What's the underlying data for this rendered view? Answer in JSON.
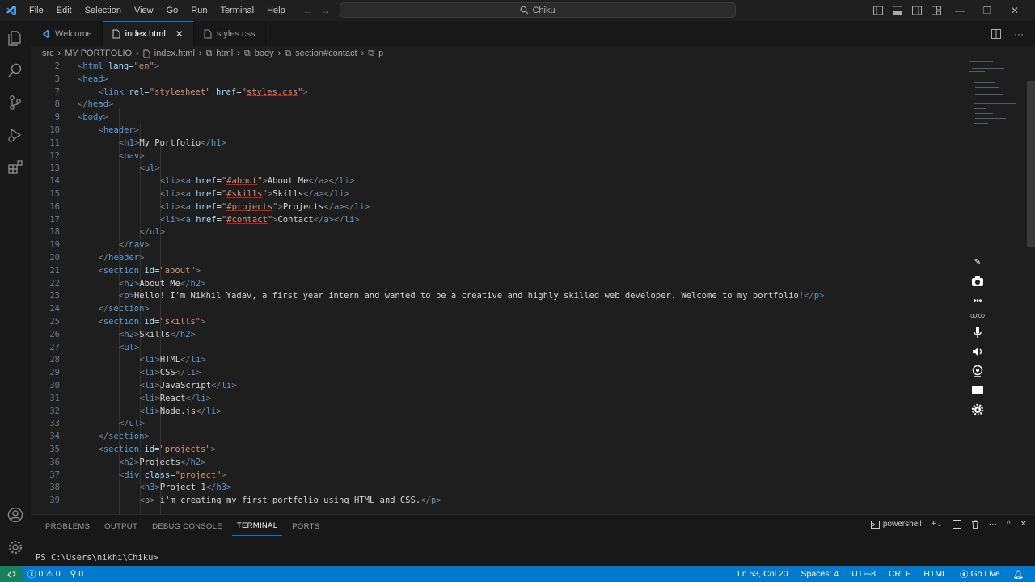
{
  "titlebar": {
    "menu": [
      "File",
      "Edit",
      "Selection",
      "View",
      "Go",
      "Run",
      "Terminal",
      "Help"
    ],
    "search_text": "Chiku"
  },
  "tabs": [
    {
      "label": "Welcome",
      "active": false
    },
    {
      "label": "index.html",
      "active": true
    },
    {
      "label": "styles.css",
      "active": false
    }
  ],
  "breadcrumb": [
    "src",
    "MY PORTFOLIO",
    "index.html",
    "html",
    "body",
    "section#contact",
    "p"
  ],
  "code_lines": [
    {
      "n": "2",
      "ind": 1,
      "t": [
        [
          "b",
          "<"
        ],
        [
          "g",
          "html"
        ],
        [
          "s",
          " "
        ],
        [
          "a",
          "lang"
        ],
        [
          "s",
          "="
        ],
        [
          "r",
          "\"en\""
        ],
        [
          "b",
          ">"
        ]
      ]
    },
    {
      "n": "3",
      "ind": 1,
      "t": [
        [
          "b",
          "<"
        ],
        [
          "g",
          "head"
        ],
        [
          "b",
          ">"
        ]
      ]
    },
    {
      "n": "7",
      "ind": 2,
      "t": [
        [
          "b",
          "<"
        ],
        [
          "g",
          "link"
        ],
        [
          "s",
          " "
        ],
        [
          "a",
          "rel"
        ],
        [
          "s",
          "="
        ],
        [
          "r",
          "\"stylesheet\""
        ],
        [
          "s",
          " "
        ],
        [
          "a",
          "href"
        ],
        [
          "s",
          "="
        ],
        [
          "r",
          "\""
        ],
        [
          "u",
          "styles.css"
        ],
        [
          "r",
          "\""
        ],
        [
          "b",
          ">"
        ]
      ]
    },
    {
      "n": "8",
      "ind": 1,
      "t": [
        [
          "b",
          "</"
        ],
        [
          "g",
          "head"
        ],
        [
          "b",
          ">"
        ]
      ]
    },
    {
      "n": "9",
      "ind": 1,
      "t": [
        [
          "b",
          "<"
        ],
        [
          "g",
          "body"
        ],
        [
          "b",
          ">"
        ]
      ]
    },
    {
      "n": "10",
      "ind": 2,
      "t": [
        [
          "b",
          "<"
        ],
        [
          "g",
          "header"
        ],
        [
          "b",
          ">"
        ]
      ]
    },
    {
      "n": "11",
      "ind": 3,
      "t": [
        [
          "b",
          "<"
        ],
        [
          "g",
          "h1"
        ],
        [
          "b",
          ">"
        ],
        [
          "x",
          "My Portfolio"
        ],
        [
          "b",
          "</"
        ],
        [
          "g",
          "h1"
        ],
        [
          "b",
          ">"
        ]
      ]
    },
    {
      "n": "12",
      "ind": 3,
      "t": [
        [
          "b",
          "<"
        ],
        [
          "g",
          "nav"
        ],
        [
          "b",
          ">"
        ]
      ]
    },
    {
      "n": "13",
      "ind": 4,
      "t": [
        [
          "b",
          "<"
        ],
        [
          "g",
          "ul"
        ],
        [
          "b",
          ">"
        ]
      ]
    },
    {
      "n": "14",
      "ind": 5,
      "t": [
        [
          "b",
          "<"
        ],
        [
          "g",
          "li"
        ],
        [
          "b",
          "><"
        ],
        [
          "g",
          "a"
        ],
        [
          "s",
          " "
        ],
        [
          "a",
          "href"
        ],
        [
          "s",
          "="
        ],
        [
          "r",
          "\""
        ],
        [
          "u",
          "#about"
        ],
        [
          "r",
          "\""
        ],
        [
          "b",
          ">"
        ],
        [
          "x",
          "About Me"
        ],
        [
          "b",
          "</"
        ],
        [
          "g",
          "a"
        ],
        [
          "b",
          "></"
        ],
        [
          "g",
          "li"
        ],
        [
          "b",
          ">"
        ]
      ]
    },
    {
      "n": "15",
      "ind": 5,
      "t": [
        [
          "b",
          "<"
        ],
        [
          "g",
          "li"
        ],
        [
          "b",
          "><"
        ],
        [
          "g",
          "a"
        ],
        [
          "s",
          " "
        ],
        [
          "a",
          "href"
        ],
        [
          "s",
          "="
        ],
        [
          "r",
          "\""
        ],
        [
          "u",
          "#skills"
        ],
        [
          "r",
          "\""
        ],
        [
          "b",
          ">"
        ],
        [
          "x",
          "Skills"
        ],
        [
          "b",
          "</"
        ],
        [
          "g",
          "a"
        ],
        [
          "b",
          "></"
        ],
        [
          "g",
          "li"
        ],
        [
          "b",
          ">"
        ]
      ]
    },
    {
      "n": "16",
      "ind": 5,
      "t": [
        [
          "b",
          "<"
        ],
        [
          "g",
          "li"
        ],
        [
          "b",
          "><"
        ],
        [
          "g",
          "a"
        ],
        [
          "s",
          " "
        ],
        [
          "a",
          "href"
        ],
        [
          "s",
          "="
        ],
        [
          "r",
          "\""
        ],
        [
          "u",
          "#projects"
        ],
        [
          "r",
          "\""
        ],
        [
          "b",
          ">"
        ],
        [
          "x",
          "Projects"
        ],
        [
          "b",
          "</"
        ],
        [
          "g",
          "a"
        ],
        [
          "b",
          "></"
        ],
        [
          "g",
          "li"
        ],
        [
          "b",
          ">"
        ]
      ]
    },
    {
      "n": "17",
      "ind": 5,
      "t": [
        [
          "b",
          "<"
        ],
        [
          "g",
          "li"
        ],
        [
          "b",
          "><"
        ],
        [
          "g",
          "a"
        ],
        [
          "s",
          " "
        ],
        [
          "a",
          "href"
        ],
        [
          "s",
          "="
        ],
        [
          "r",
          "\""
        ],
        [
          "u",
          "#contact"
        ],
        [
          "r",
          "\""
        ],
        [
          "b",
          ">"
        ],
        [
          "x",
          "Contact"
        ],
        [
          "b",
          "</"
        ],
        [
          "g",
          "a"
        ],
        [
          "b",
          "></"
        ],
        [
          "g",
          "li"
        ],
        [
          "b",
          ">"
        ]
      ]
    },
    {
      "n": "18",
      "ind": 4,
      "t": [
        [
          "b",
          "</"
        ],
        [
          "g",
          "ul"
        ],
        [
          "b",
          ">"
        ]
      ]
    },
    {
      "n": "19",
      "ind": 3,
      "t": [
        [
          "b",
          "</"
        ],
        [
          "g",
          "nav"
        ],
        [
          "b",
          ">"
        ]
      ]
    },
    {
      "n": "20",
      "ind": 2,
      "t": [
        [
          "b",
          "</"
        ],
        [
          "g",
          "header"
        ],
        [
          "b",
          ">"
        ]
      ]
    },
    {
      "n": "21",
      "ind": 2,
      "t": [
        [
          "b",
          "<"
        ],
        [
          "g",
          "section"
        ],
        [
          "s",
          " "
        ],
        [
          "a",
          "id"
        ],
        [
          "s",
          "="
        ],
        [
          "r",
          "\"about\""
        ],
        [
          "b",
          ">"
        ]
      ]
    },
    {
      "n": "22",
      "ind": 3,
      "t": [
        [
          "b",
          "<"
        ],
        [
          "g",
          "h2"
        ],
        [
          "b",
          ">"
        ],
        [
          "x",
          "About Me"
        ],
        [
          "b",
          "</"
        ],
        [
          "g",
          "h2"
        ],
        [
          "b",
          ">"
        ]
      ]
    },
    {
      "n": "23",
      "ind": 3,
      "t": [
        [
          "b",
          "<"
        ],
        [
          "g",
          "p"
        ],
        [
          "b",
          ">"
        ],
        [
          "x",
          "Hello! I'm Nikhil Yadav, a first year intern and wanted to be a creative and highly skilled web developer. Welcome to my portfolio!"
        ],
        [
          "b",
          "</"
        ],
        [
          "g",
          "p"
        ],
        [
          "b",
          ">"
        ]
      ]
    },
    {
      "n": "24",
      "ind": 2,
      "t": [
        [
          "b",
          "</"
        ],
        [
          "g",
          "section"
        ],
        [
          "b",
          ">"
        ]
      ]
    },
    {
      "n": "25",
      "ind": 2,
      "t": [
        [
          "b",
          "<"
        ],
        [
          "g",
          "section"
        ],
        [
          "s",
          " "
        ],
        [
          "a",
          "id"
        ],
        [
          "s",
          "="
        ],
        [
          "r",
          "\"skills\""
        ],
        [
          "b",
          ">"
        ]
      ]
    },
    {
      "n": "26",
      "ind": 3,
      "t": [
        [
          "b",
          "<"
        ],
        [
          "g",
          "h2"
        ],
        [
          "b",
          ">"
        ],
        [
          "x",
          "Skills"
        ],
        [
          "b",
          "</"
        ],
        [
          "g",
          "h2"
        ],
        [
          "b",
          ">"
        ]
      ]
    },
    {
      "n": "27",
      "ind": 3,
      "t": [
        [
          "b",
          "<"
        ],
        [
          "g",
          "ul"
        ],
        [
          "b",
          ">"
        ]
      ]
    },
    {
      "n": "28",
      "ind": 4,
      "t": [
        [
          "b",
          "<"
        ],
        [
          "g",
          "li"
        ],
        [
          "b",
          ">"
        ],
        [
          "x",
          "HTML"
        ],
        [
          "b",
          "</"
        ],
        [
          "g",
          "li"
        ],
        [
          "b",
          ">"
        ]
      ]
    },
    {
      "n": "29",
      "ind": 4,
      "t": [
        [
          "b",
          "<"
        ],
        [
          "g",
          "li"
        ],
        [
          "b",
          ">"
        ],
        [
          "x",
          "CSS"
        ],
        [
          "b",
          "</"
        ],
        [
          "g",
          "li"
        ],
        [
          "b",
          ">"
        ]
      ]
    },
    {
      "n": "30",
      "ind": 4,
      "t": [
        [
          "b",
          "<"
        ],
        [
          "g",
          "li"
        ],
        [
          "b",
          ">"
        ],
        [
          "x",
          "JavaScript"
        ],
        [
          "b",
          "</"
        ],
        [
          "g",
          "li"
        ],
        [
          "b",
          ">"
        ]
      ]
    },
    {
      "n": "31",
      "ind": 4,
      "t": [
        [
          "b",
          "<"
        ],
        [
          "g",
          "li"
        ],
        [
          "b",
          ">"
        ],
        [
          "x",
          "React"
        ],
        [
          "b",
          "</"
        ],
        [
          "g",
          "li"
        ],
        [
          "b",
          ">"
        ]
      ]
    },
    {
      "n": "32",
      "ind": 4,
      "t": [
        [
          "b",
          "<"
        ],
        [
          "g",
          "li"
        ],
        [
          "b",
          ">"
        ],
        [
          "x",
          "Node.js"
        ],
        [
          "b",
          "</"
        ],
        [
          "g",
          "li"
        ],
        [
          "b",
          ">"
        ]
      ]
    },
    {
      "n": "33",
      "ind": 3,
      "t": [
        [
          "b",
          "</"
        ],
        [
          "g",
          "ul"
        ],
        [
          "b",
          ">"
        ]
      ]
    },
    {
      "n": "34",
      "ind": 2,
      "t": [
        [
          "b",
          "</"
        ],
        [
          "g",
          "section"
        ],
        [
          "b",
          ">"
        ]
      ]
    },
    {
      "n": "35",
      "ind": 2,
      "t": [
        [
          "b",
          "<"
        ],
        [
          "g",
          "section"
        ],
        [
          "s",
          " "
        ],
        [
          "a",
          "id"
        ],
        [
          "s",
          "="
        ],
        [
          "r",
          "\"projects\""
        ],
        [
          "b",
          ">"
        ]
      ]
    },
    {
      "n": "36",
      "ind": 3,
      "t": [
        [
          "b",
          "<"
        ],
        [
          "g",
          "h2"
        ],
        [
          "b",
          ">"
        ],
        [
          "x",
          "Projects"
        ],
        [
          "b",
          "</"
        ],
        [
          "g",
          "h2"
        ],
        [
          "b",
          ">"
        ]
      ]
    },
    {
      "n": "37",
      "ind": 3,
      "t": [
        [
          "b",
          "<"
        ],
        [
          "g",
          "div"
        ],
        [
          "s",
          " "
        ],
        [
          "a",
          "class"
        ],
        [
          "s",
          "="
        ],
        [
          "r",
          "\"project\""
        ],
        [
          "b",
          ">"
        ]
      ]
    },
    {
      "n": "38",
      "ind": 4,
      "t": [
        [
          "b",
          "<"
        ],
        [
          "g",
          "h3"
        ],
        [
          "b",
          ">"
        ],
        [
          "x",
          "Project 1"
        ],
        [
          "b",
          "</"
        ],
        [
          "g",
          "h3"
        ],
        [
          "b",
          ">"
        ]
      ]
    },
    {
      "n": "39",
      "ind": 4,
      "t": [
        [
          "b",
          "<"
        ],
        [
          "g",
          "p"
        ],
        [
          "b",
          ">"
        ],
        [
          "x",
          " i'm creating my first portfolio using HTML and CSS."
        ],
        [
          "b",
          "</"
        ],
        [
          "g",
          "p"
        ],
        [
          "b",
          ">"
        ]
      ]
    }
  ],
  "overlay": {
    "time": "00:00"
  },
  "panel": {
    "tabs": [
      "PROBLEMS",
      "OUTPUT",
      "DEBUG CONSOLE",
      "TERMINAL",
      "PORTS"
    ],
    "active_tab": "TERMINAL",
    "shell": "powershell",
    "prompt": "PS C:\\Users\\nikhi\\Chiku>"
  },
  "status": {
    "errors": "0",
    "warnings": "0",
    "ports": "0",
    "position": "Ln 53, Col 20",
    "spaces": "Spaces: 4",
    "encoding": "UTF-8",
    "eol": "CRLF",
    "language": "HTML",
    "live": "Go Live"
  },
  "colors": {
    "accent": "#007acc",
    "tag": "#569cd6",
    "attribute": "#9cdcfe",
    "string": "#ce9178",
    "text": "#d4d4d4"
  }
}
